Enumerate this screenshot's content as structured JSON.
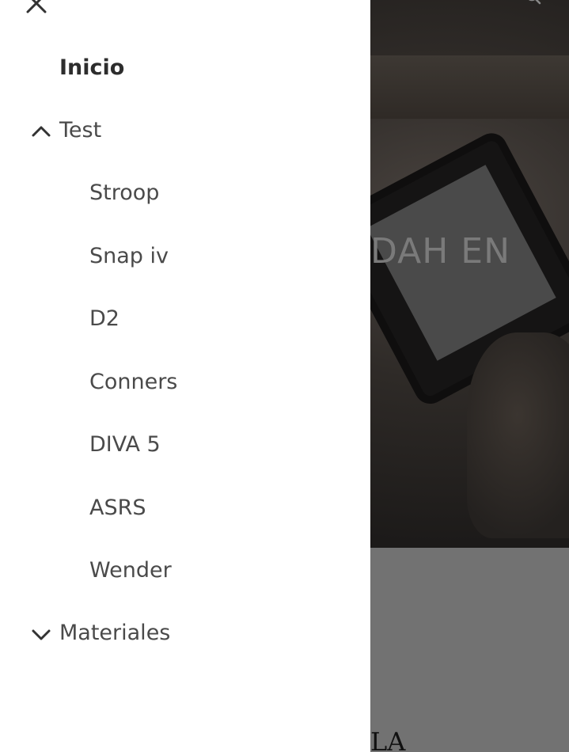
{
  "drawer": {
    "close_icon": "close-icon",
    "items": [
      {
        "label": "Inicio"
      },
      {
        "label": "Test",
        "expanded": true,
        "icon": "chevron-up-icon"
      },
      {
        "label": "Stroop"
      },
      {
        "label": "Snap iv"
      },
      {
        "label": "D2"
      },
      {
        "label": "Conners"
      },
      {
        "label": "DIVA 5"
      },
      {
        "label": "ASRS"
      },
      {
        "label": "Wender"
      },
      {
        "label": "Materiales",
        "expanded": false,
        "icon": "chevron-down-icon"
      }
    ]
  },
  "background": {
    "hero_title_fragment": "DAH EN",
    "bottom_text_fragment": "LA",
    "search_icon": "search-icon"
  }
}
